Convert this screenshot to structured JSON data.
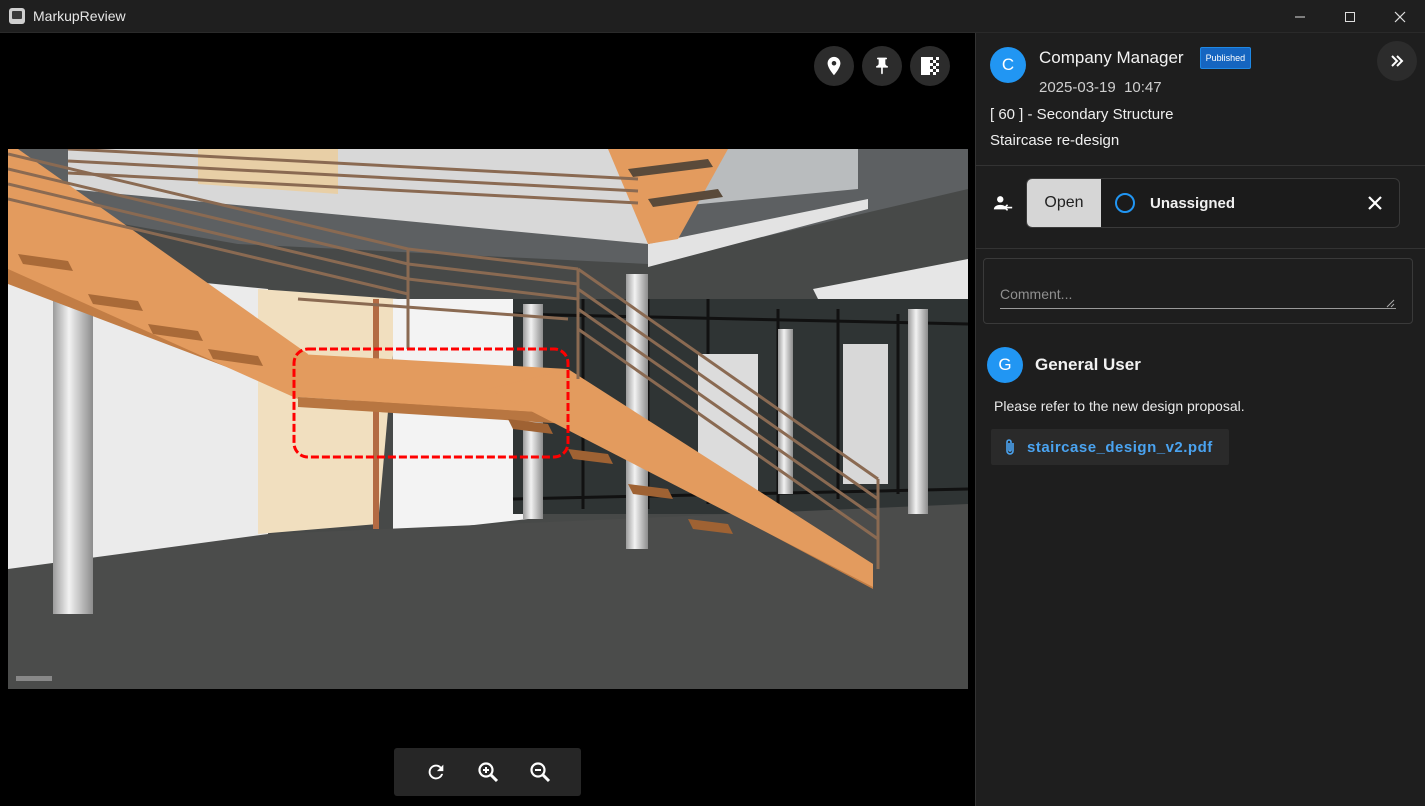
{
  "window": {
    "title": "MarkupReview",
    "minimize": "—",
    "maximize": "☐",
    "close": "✕"
  },
  "viewer": {
    "tools": [
      {
        "name": "location-icon"
      },
      {
        "name": "pin-icon"
      },
      {
        "name": "transparency-icon"
      }
    ],
    "zoom_controls": [
      "reset-view-icon",
      "zoom-in-icon",
      "zoom-out-icon"
    ]
  },
  "markup": {
    "author_initial": "C",
    "author": "Company Manager",
    "badge": "Published",
    "date": "2025-03-19",
    "time": "10:47",
    "category": "[ 60 ] - Secondary Structure",
    "subject": "Staircase re-design"
  },
  "status": {
    "state": "Open",
    "assignee": "Unassigned"
  },
  "comment": {
    "placeholder": "Comment..."
  },
  "reply": {
    "author_initial": "G",
    "author": "General User",
    "text": "Please refer to the new design proposal.",
    "attachment": "staircase_design_v2.pdf"
  },
  "colors": {
    "accent": "#2196f3",
    "badge": "#1565c0",
    "link": "#4aa3f0",
    "markup_cloud": "#ff0000",
    "stair": "#e39b5e"
  }
}
